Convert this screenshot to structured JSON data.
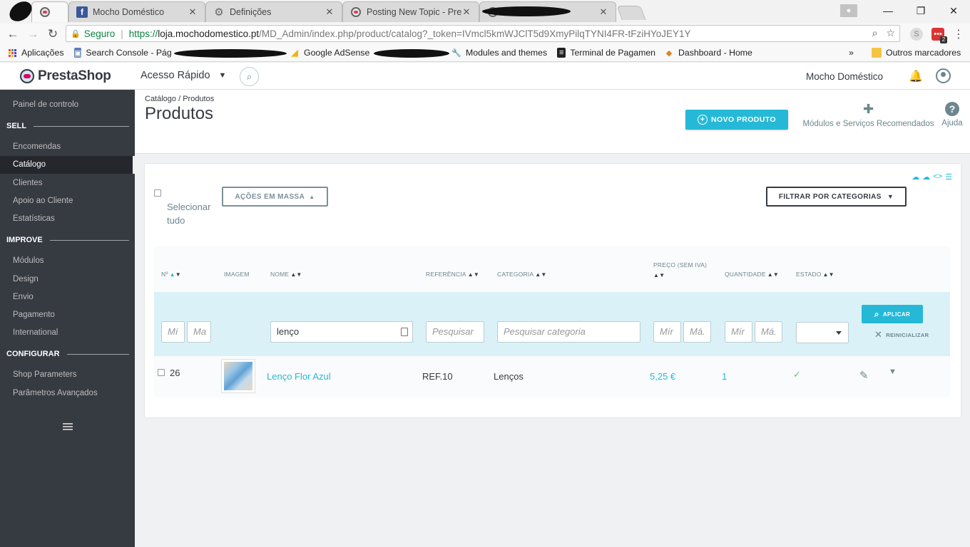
{
  "browser": {
    "tabs": [
      {
        "title": "",
        "active": true
      },
      {
        "title": "Mocho Doméstico",
        "icon": "facebook-icon"
      },
      {
        "title": "Definições",
        "icon": "gear-icon"
      },
      {
        "title": "Posting New Topic - Pres",
        "icon": "prestashop-icon"
      },
      {
        "title": "",
        "icon": "prestashop-icon"
      }
    ],
    "close_glyph": "✕",
    "security_label": "Seguro",
    "url_scheme": "https://",
    "url_host": "loja.mochodomestico.pt",
    "url_path": "/MD_Admin/index.php/product/catalog?_token=IVmcl5kmWJClT5d9XmyPilqTYNI4FR-tFziHYoJEY1Y",
    "bookmarks": [
      {
        "label": "Aplicações",
        "icon": "apps-icon"
      },
      {
        "label": "Search Console - Pág",
        "icon": "search-console-icon"
      },
      {
        "label": "Google AdSense",
        "icon": "adsense-icon"
      },
      {
        "label": "Modules and themes",
        "icon": "wrench-icon"
      },
      {
        "label": "Terminal de Pagamen",
        "icon": "terminal-icon"
      },
      {
        "label": "Dashboard - Home",
        "icon": "dashboard-icon"
      }
    ],
    "bookmarks_overflow": "»",
    "other_bookmarks": "Outros marcadores",
    "ext_badge": "2"
  },
  "header": {
    "logo_text": "PrestaShop",
    "quick_access": "Acesso Rápido",
    "shop_name": "Mocho Doméstico"
  },
  "sidebar": {
    "dashboard": "Painel de controlo",
    "sections": [
      {
        "title": "SELL",
        "items": [
          "Encomendas",
          "Catálogo",
          "Clientes",
          "Apoio ao Cliente",
          "Estatísticas"
        ]
      },
      {
        "title": "IMPROVE",
        "items": [
          "Módulos",
          "Design",
          "Envio",
          "Pagamento",
          "International"
        ]
      },
      {
        "title": "CONFIGURAR",
        "items": [
          "Shop Parameters",
          "Parâmetros Avançados"
        ]
      }
    ],
    "active_item": "Catálogo"
  },
  "page": {
    "breadcrumb": "Catálogo / Produtos",
    "title": "Produtos",
    "new_product": "NOVO PRODUTO",
    "modules_recommended": "Módulos e Serviços Recomendados",
    "help": "Ajuda"
  },
  "catalog": {
    "select_all": "Selecionar tudo",
    "bulk_actions": "AÇÕES EM MASSA",
    "filter_by_categories": "FILTRAR POR CATEGORIAS",
    "columns": {
      "id": "Nº",
      "image": "IMAGEM",
      "name": "NOME",
      "reference": "REFERÊNCIA",
      "category": "CATEGORIA",
      "price": "PREÇO (SEM IVA)",
      "quantity": "QUANTIDADE",
      "status": "ESTADO"
    },
    "filters": {
      "id_min_placeholder": "Mí",
      "id_max_placeholder": "Ma",
      "name_value": "lenço",
      "reference_placeholder": "Pesquisar",
      "category_placeholder": "Pesquisar categoria",
      "price_min_placeholder": "Mír",
      "price_max_placeholder": "Má.",
      "qty_min_placeholder": "Mír",
      "qty_max_placeholder": "Má.",
      "apply": "APLICAR",
      "reset": "REINICIALIZAR"
    },
    "rows": [
      {
        "id": "26",
        "name": "Lenço Flor Azul",
        "reference": "REF.10",
        "category": "Lenços",
        "price": "5,25 €",
        "quantity": "1",
        "status": "✓"
      }
    ]
  },
  "colors": {
    "accent": "#25b9d7",
    "sidebar_bg": "#363a41",
    "filter_row_bg": "#daf2f7",
    "status_ok": "#70b580"
  }
}
